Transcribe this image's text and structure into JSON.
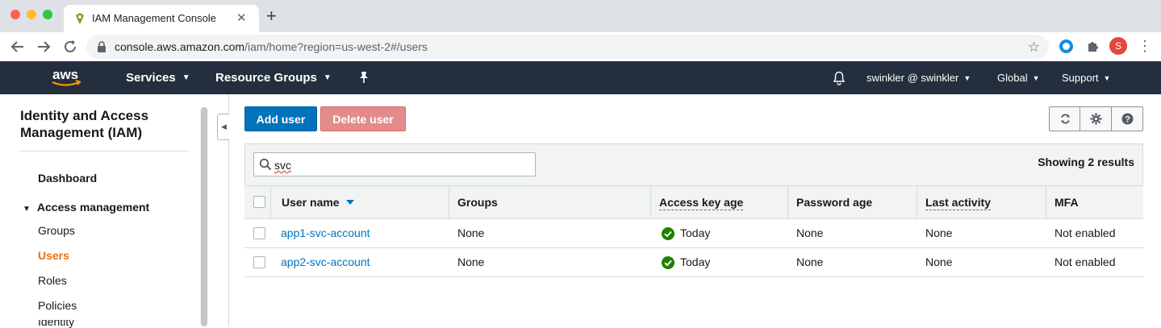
{
  "browser": {
    "tab_title": "IAM Management Console",
    "new_tab": "+",
    "close": "✕",
    "url_host": "console.aws.amazon.com",
    "url_path": "/iam/home?region=us-west-2#/users",
    "profile_initial": "S"
  },
  "aws_header": {
    "logo": "aws",
    "services": "Services",
    "resource_groups": "Resource Groups",
    "account": "swinkler @ swinkler",
    "region": "Global",
    "support": "Support"
  },
  "sidebar": {
    "title": "Identity and Access Management (IAM)",
    "dashboard": "Dashboard",
    "section": "Access management",
    "items": [
      {
        "label": "Groups"
      },
      {
        "label": "Users"
      },
      {
        "label": "Roles"
      },
      {
        "label": "Policies"
      }
    ],
    "truncated_item": "Identity providers"
  },
  "toolbar": {
    "add_user": "Add user",
    "delete_user": "Delete user"
  },
  "search": {
    "value": "svc"
  },
  "results": "Showing 2 results",
  "table": {
    "columns": [
      "User name",
      "Groups",
      "Access key age",
      "Password age",
      "Last activity",
      "MFA"
    ],
    "rows": [
      {
        "user": "app1-svc-account",
        "groups": "None",
        "key_age": "Today",
        "password_age": "None",
        "last_activity": "None",
        "mfa": "Not enabled"
      },
      {
        "user": "app2-svc-account",
        "groups": "None",
        "key_age": "Today",
        "password_age": "None",
        "last_activity": "None",
        "mfa": "Not enabled"
      }
    ]
  },
  "colors": {
    "aws_header": "#232f3e",
    "primary": "#0073bb",
    "active_nav": "#ec7211",
    "ok_green": "#1d8102"
  }
}
